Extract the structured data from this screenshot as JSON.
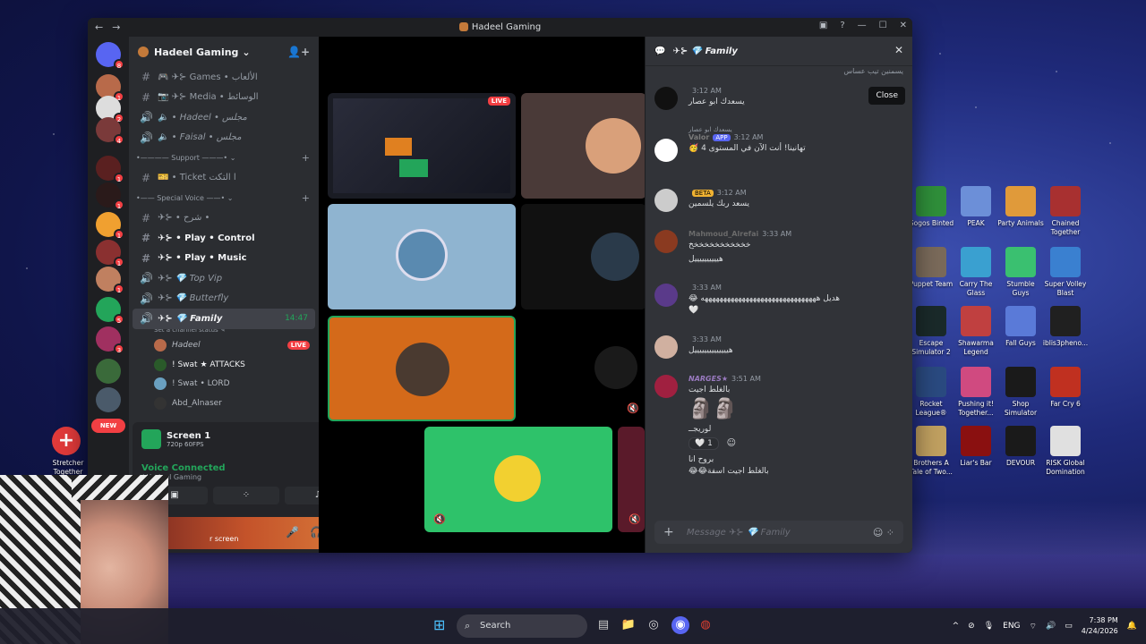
{
  "window": {
    "title": "Hadeel Gaming",
    "nav_back": "←",
    "nav_forward": "→",
    "controls": [
      "▣",
      "?",
      "—",
      "☐",
      "✕"
    ]
  },
  "servers": {
    "new_label": "NEW",
    "badges": [
      "8",
      "1",
      "2",
      "4",
      "1",
      "1",
      "1",
      "1",
      "1",
      "5",
      "3"
    ]
  },
  "guild": {
    "name": "Hadeel Gaming",
    "channels": [
      {
        "icon": "#",
        "label": "🎮 ✈⊱ Games • الألعاب",
        "type": "text"
      },
      {
        "icon": "#",
        "label": "📷 ✈⊱ Media • الوسائط",
        "type": "text"
      },
      {
        "icon": "🔊",
        "label": "🔈 • Hadeel • مجلس",
        "type": "voice"
      },
      {
        "icon": "🔊",
        "label": "🔈 • Faisal • مجلس",
        "type": "voice"
      },
      {
        "icon": "",
        "label": "•———— Support ———• ⌄",
        "type": "category"
      },
      {
        "icon": "#",
        "label": "🎫 • Ticket ا التكت",
        "type": "text"
      },
      {
        "icon": "",
        "label": "•—— Special Voice ——• ⌄",
        "type": "category"
      },
      {
        "icon": "#",
        "label": "✈⊱ • شرح •",
        "type": "text"
      },
      {
        "icon": "#",
        "label": "✈⊱ • Play • Control",
        "type": "bold"
      },
      {
        "icon": "#",
        "label": "✈⊱ • Play • Music",
        "type": "bold"
      },
      {
        "icon": "🔊",
        "label": "✈⊱ 💎 Top Vip",
        "type": "voice"
      },
      {
        "icon": "🔊",
        "label": "✈⊱ 💎 Butterfly",
        "type": "voice"
      }
    ],
    "active_channel": {
      "label": "✈⊱ 💎 Family",
      "time": "14:47",
      "status": "Set a channel status ✎"
    },
    "voice_users": [
      {
        "name": "Hadeel",
        "live": "LIVE"
      },
      {
        "name": "! Swat ★ ATTACKS",
        "live": ""
      },
      {
        "name": "! Swat • LORD",
        "live": ""
      },
      {
        "name": "Abd_Alnaser",
        "live": ""
      }
    ]
  },
  "panel": {
    "screen_title": "Screen 1",
    "screen_sub": "720p 60FPS",
    "voice_connected": "Voice Connected",
    "voice_sub": "/ Hadeel Gaming",
    "user_text": "r screen"
  },
  "stage": {
    "live_label": "LIVE"
  },
  "chat": {
    "title": "✈⊱ 💎 Family",
    "close_tooltip": "Close",
    "top_cut": "يسمنين تيب عساس",
    "messages": [
      {
        "name": "",
        "time": "3:12 AM",
        "body": "يسعدك ابو عصار",
        "tag": ""
      },
      {
        "reply": "يسعدك ابو عصار",
        "name": "Valor",
        "tag": "APP",
        "time": "3:12 AM",
        "body": "تهانينا! أنت الآن في المستوى 4 🥳"
      },
      {
        "name": "",
        "tag": "BETA",
        "time": "3:12 AM",
        "body": "يسعد ربك يلسمين"
      },
      {
        "name": "Mahmoud_Alrefai",
        "time": "3:33 AM",
        "body": "خخخخخخخخخخخخ",
        "body2": "هييييييييييل"
      },
      {
        "name": "",
        "time": "3:33 AM",
        "body": "هديل هههههههههههههههههههههههههههههههه 😂",
        "body2": "🤍"
      },
      {
        "name": "",
        "time": "3:33 AM",
        "body": "هييييييييييييييل"
      },
      {
        "name": "NARGES★",
        "time": "3:51 AM",
        "body": "بالغلط اجيت",
        "body2": "🗿🗿",
        "body3": "لوريجــ",
        "react": "🤍 1",
        "body4": "بروح انا",
        "body5": "بالغلط اجيت اسفة😂😂"
      }
    ],
    "input_placeholder": "Message ✈⊱ 💎 Family"
  },
  "desktop_icons": [
    {
      "label": "Gogos Binted",
      "color": "#2f8f3a"
    },
    {
      "label": "PEAK",
      "color": "#6c8fd8"
    },
    {
      "label": "Party Animals",
      "color": "#e09a3a"
    },
    {
      "label": "Chained Together",
      "color": "#a83030"
    },
    {
      "label": "Puppet Team",
      "color": "#7a6a5a"
    },
    {
      "label": "Carry The Glass",
      "color": "#3aa0d0"
    },
    {
      "label": "Stumble Guys",
      "color": "#3ac070"
    },
    {
      "label": "Super Volley Blast",
      "color": "#3a80d0"
    },
    {
      "label": "Escape Simulator 2",
      "color": "#1a2a2a"
    },
    {
      "label": "Shawarma Legend",
      "color": "#c04040"
    },
    {
      "label": "Fall Guys",
      "color": "#5a7ad8"
    },
    {
      "label": "iblis3pheno...",
      "color": "#202020"
    },
    {
      "label": "Rocket League®",
      "color": "#2a4a80"
    },
    {
      "label": "Pushing it! Together...",
      "color": "#d04a80"
    },
    {
      "label": "Shop Simulator",
      "color": "#1a1a1a"
    },
    {
      "label": "Far Cry 6",
      "color": "#c03020"
    },
    {
      "label": "Brothers A Tale of Two...",
      "color": "#c0a060"
    },
    {
      "label": "Liar's Bar",
      "color": "#8a1010"
    },
    {
      "label": "DEVOUR",
      "color": "#1a1a1a"
    },
    {
      "label": "RISK Global Domination",
      "color": "#e0e0e0"
    }
  ],
  "stretcher_label": "Stretcher Together",
  "taskbar": {
    "search": "Search",
    "lang": "ENG",
    "time": "7:38 PM",
    "date": "4/24/2026"
  },
  "colors": {
    "discord_bg": "#313338",
    "accent": "#5865f2",
    "live": "#f23f43",
    "online": "#23a55a"
  }
}
